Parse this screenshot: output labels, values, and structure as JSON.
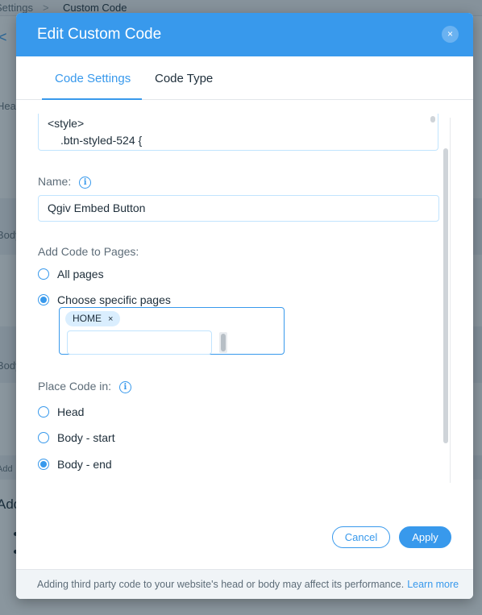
{
  "background": {
    "breadcrumb_root": "Settings",
    "breadcrumb_sep": ">",
    "breadcrumb_current": "Custom Code",
    "back_glyph": "<",
    "label_head": "Head",
    "label_body1": "Body",
    "label_body2": "Body",
    "label_add": "Add",
    "big_text": "Add"
  },
  "modal": {
    "title": "Edit Custom Code",
    "close_glyph": "×",
    "tabs": [
      {
        "label": "Code Settings",
        "active": true
      },
      {
        "label": "Code Type",
        "active": false
      }
    ],
    "code": {
      "line1": "<style>",
      "line2": ".btn-styled-524 {"
    },
    "name": {
      "label": "Name:",
      "value": "Qgiv Embed Button"
    },
    "add_to_pages": {
      "label": "Add Code to Pages:",
      "options": [
        {
          "label": "All pages",
          "checked": false
        },
        {
          "label": "Choose specific pages",
          "checked": true
        }
      ],
      "selected_pages": [
        {
          "label": "HOME",
          "remove_glyph": "×"
        }
      ]
    },
    "place_code": {
      "label": "Place Code in:",
      "options": [
        {
          "label": "Head",
          "checked": false
        },
        {
          "label": "Body - start",
          "checked": false
        },
        {
          "label": "Body - end",
          "checked": true
        }
      ]
    },
    "info_glyph": "i",
    "buttons": {
      "cancel": "Cancel",
      "apply": "Apply"
    },
    "footer": {
      "text": "Adding third party code to your website's head or body may affect its performance.",
      "link": "Learn more"
    }
  },
  "colors": {
    "accent": "#3899ec",
    "overlay": "rgba(22,45,61,0.5)",
    "text": "#20303c"
  }
}
